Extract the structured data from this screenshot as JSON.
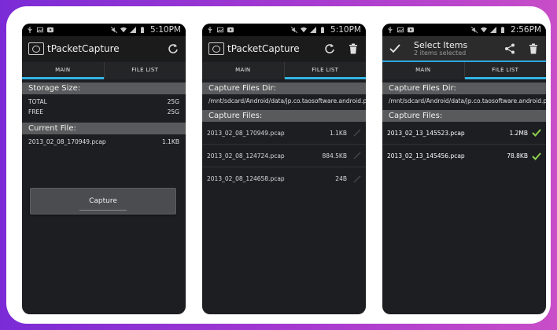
{
  "status": {
    "time_1": "5:10PM",
    "time_2": "5:10PM",
    "time_3": "2:56PM"
  },
  "app": {
    "title": "tPacketCapture"
  },
  "tabs": {
    "main": "MAIN",
    "file_list": "FILE LIST"
  },
  "screen1": {
    "storage_header": "Storage Size:",
    "total_label": "TOTAL",
    "total_value": "25G",
    "free_label": "FREE",
    "free_value": "25G",
    "current_header": "Current File:",
    "current_file": "2013_02_08_170949.pcap",
    "current_size": "1.1KB",
    "capture_label": "Capture"
  },
  "screen2": {
    "dir_header": "Capture Files Dir:",
    "dir_path": "/mnt/sdcard/Android/data/jp.co.taosoftware.android.packetcapture/files",
    "files_header": "Capture Files:",
    "files": [
      {
        "name": "2013_02_08_170949.pcap",
        "size": "1.1KB"
      },
      {
        "name": "2013_02_08_124724.pcap",
        "size": "884.5KB"
      },
      {
        "name": "2013_02_08_124658.pcap",
        "size": "24B"
      }
    ]
  },
  "screen3": {
    "select_title": "Select Items",
    "select_subtitle": "2 items selected",
    "dir_header": "Capture Files Dir:",
    "dir_path": "/mnt/sdcard/Android/data/jp.co.taosoftware.android.packetcapture/files",
    "files_header": "Capture Files:",
    "files": [
      {
        "name": "2013_02_13_145523.pcap",
        "size": "1.2MB"
      },
      {
        "name": "2013_02_13_145456.pcap",
        "size": "78.8KB"
      }
    ]
  },
  "colors": {
    "accent": "#33b5e5",
    "check": "#8fd14f",
    "background_gradient_start": "#7b2bd6",
    "background_gradient_end": "#c84ec8"
  },
  "icons": [
    "usb-icon",
    "image-icon",
    "youtube-icon",
    "mute-icon",
    "wifi-icon",
    "signal-icon",
    "battery-icon",
    "refresh-icon",
    "trash-icon",
    "share-icon",
    "check-icon",
    "edit-icon"
  ]
}
